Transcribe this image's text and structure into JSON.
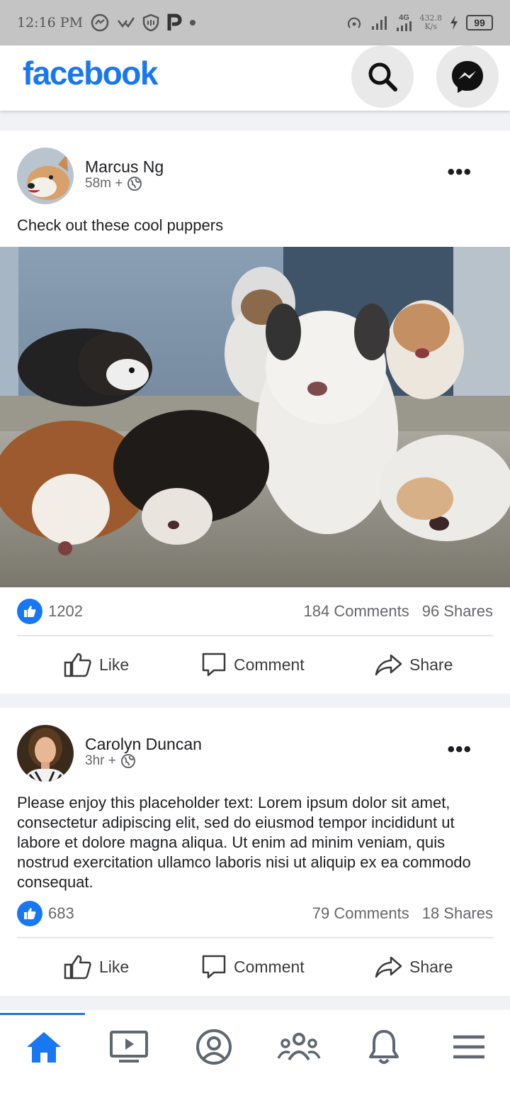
{
  "status_bar": {
    "time": "12:16 PM",
    "network": "4G",
    "speed_value": "432.8",
    "speed_unit": "K/s",
    "battery": "99"
  },
  "app": {
    "logo": "facebook",
    "brand_color": "#1877f2"
  },
  "posts": [
    {
      "author": "Marcus Ng",
      "time": "58m +",
      "text": "Check out these cool puppers",
      "likes": "1202",
      "comments": "184 Comments",
      "shares": "96 Shares"
    },
    {
      "author": "Carolyn Duncan",
      "time": "3hr +",
      "text": "Please enjoy this placeholder text: Lorem ipsum dolor sit amet, consectetur adipiscing elit, sed do eiusmod tempor incididunt ut labore et dolore magna aliqua. Ut enim ad minim veniam, quis nostrud exercitation ullamco laboris nisi ut aliquip ex ea commodo consequat.",
      "likes": "683",
      "comments": "79 Comments",
      "shares": "18 Shares"
    }
  ],
  "actions": {
    "like": "Like",
    "comment": "Comment",
    "share": "Share"
  },
  "bottom_nav": [
    "home-icon",
    "watch-icon",
    "profile-icon",
    "groups-icon",
    "notifications-icon",
    "menu-icon"
  ]
}
